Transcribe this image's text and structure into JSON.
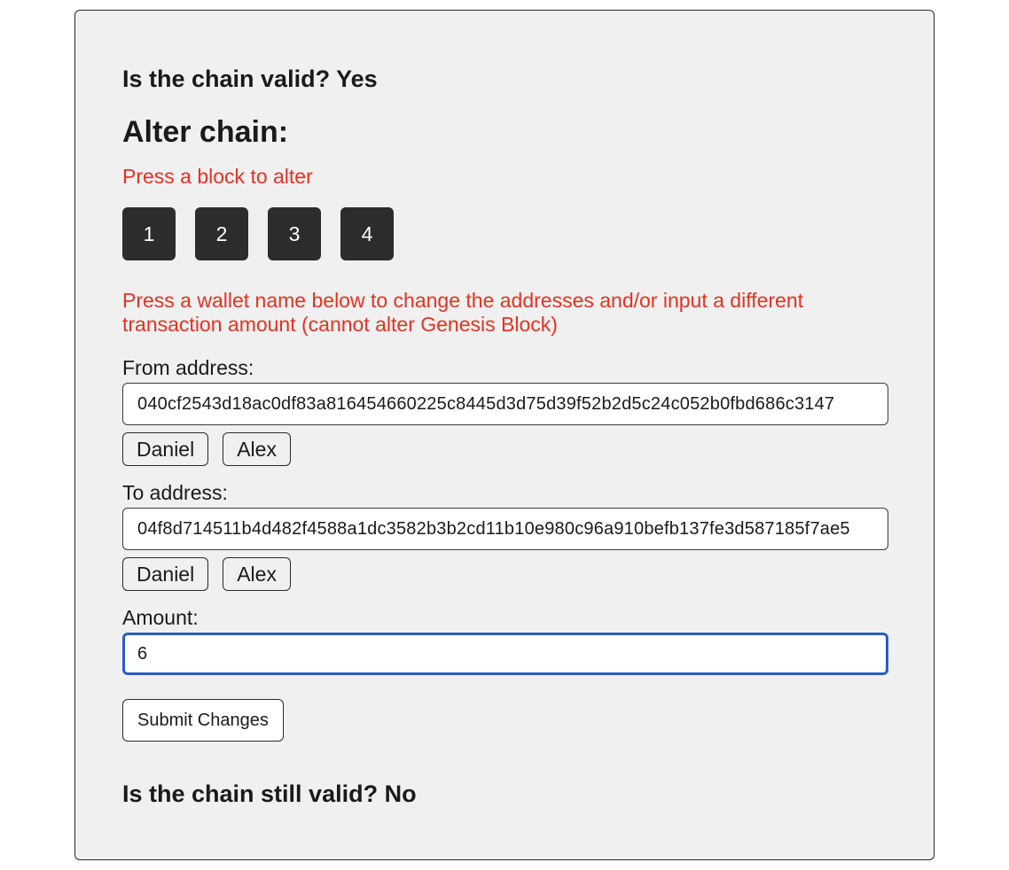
{
  "status": {
    "chain_valid": "Is the chain valid? Yes",
    "chain_still_valid": "Is the chain still valid? No"
  },
  "alter": {
    "title": "Alter chain:",
    "block_hint": "Press a block to alter",
    "blocks": [
      "1",
      "2",
      "3",
      "4"
    ],
    "wallet_hint": "Press a wallet name below to change the addresses and/or input a different transaction amount (cannot alter Genesis Block)"
  },
  "form": {
    "from_label": "From address:",
    "from_value": "040cf2543d18ac0df83a816454660225c8445d3d75d39f52b2d5c24c052b0fbd686c3147",
    "from_wallets": [
      "Daniel",
      "Alex"
    ],
    "to_label": "To address:",
    "to_value": "04f8d714511b4d482f4588a1dc3582b3b2cd11b10e980c96a910befb137fe3d587185f7ae5",
    "to_wallets": [
      "Daniel",
      "Alex"
    ],
    "amount_label": "Amount:",
    "amount_value": "6",
    "submit_label": "Submit Changes"
  },
  "colors": {
    "hint": "#e53224",
    "block_button": "#2c2c2c",
    "panel_background": "#f0f0f0",
    "focus_border": "#2a5cc8"
  }
}
